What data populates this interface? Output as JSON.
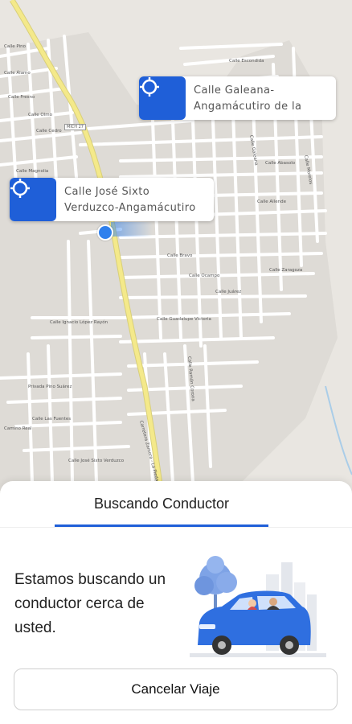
{
  "map": {
    "route_label": "MICH 27",
    "street_labels": [
      "Calle Pino",
      "Calle Álamo",
      "Calle Fresno",
      "Calle Olmo",
      "Calle Cedro",
      "Calle Magnolia",
      "Calle Escondida",
      "Calle Galeana",
      "Calle Abasolo",
      "Calle Allende",
      "Calle Morelos",
      "Calle Zaragoza",
      "Calle Bravo",
      "Calle Ocampo",
      "Calle Juárez",
      "Calle Guadalupe Victoria",
      "Calle Ignacio López Rayón",
      "Calle Ramón Corona",
      "Privada Pino Suárez",
      "Camino Real",
      "Calle Las Fuentes",
      "Calle José Sixto Verduzco",
      "Carretera Zamora - La Piedad"
    ],
    "markers": [
      {
        "icon": "crosshair-icon",
        "line1": "Calle Galeana-",
        "line2": "Angamácutiro de la"
      },
      {
        "icon": "crosshair-icon",
        "line1": "Calle José Sixto",
        "line2": "Verduzco-Angamácutiro"
      }
    ]
  },
  "sheet": {
    "tab_label": "Buscando Conductor",
    "message": "Estamos buscando un conductor cerca de usted.",
    "cancel_label": "Cancelar Viaje"
  },
  "colors": {
    "accent": "#1f5fd8",
    "location_dot": "#2f80ed",
    "highway": "#f4e98a",
    "car": "#2f6fe0"
  }
}
